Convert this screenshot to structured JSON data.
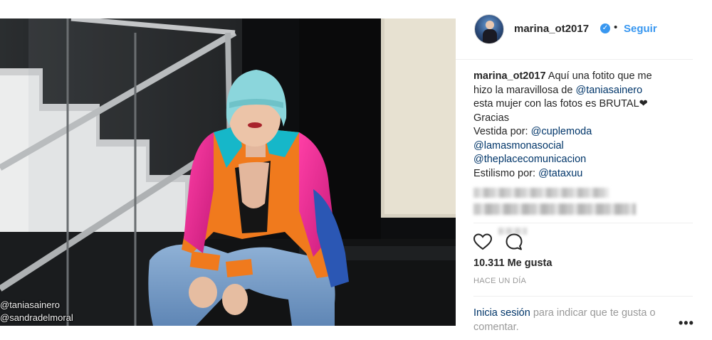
{
  "photo": {
    "credits": [
      "@taniasainero",
      "@sandradelmoral"
    ]
  },
  "post": {
    "username": "marina_ot2017",
    "verified_icon": "verified-badge-icon",
    "separator": "•",
    "follow_label": "Seguir",
    "caption_lines": [
      {
        "text": "Aquí una fotito que me"
      },
      {
        "pre": "hizo la maravillosa de ",
        "mention": "@taniasainero"
      },
      {
        "text": "esta mujer con las fotos es BRUTAL❤"
      },
      {
        "text": "Gracias"
      },
      {
        "pre": "Vestida por: ",
        "mention": "@cuplemoda"
      },
      {
        "mention": "@lamasmonasocial"
      },
      {
        "mention": "@theplacecomunicacion"
      },
      {
        "pre": "Estilismo por: ",
        "mention": "@tataxuu"
      }
    ],
    "likes": "10.311 Me gusta",
    "timestamp": "HACE UN DÍA",
    "login_link": "Inicia sesión",
    "login_rest": " para indicar que te gusta o comentar.",
    "more_label": "•••"
  },
  "colors": {
    "accent": "#3897f0",
    "mention": "#003569",
    "muted": "#999999"
  }
}
